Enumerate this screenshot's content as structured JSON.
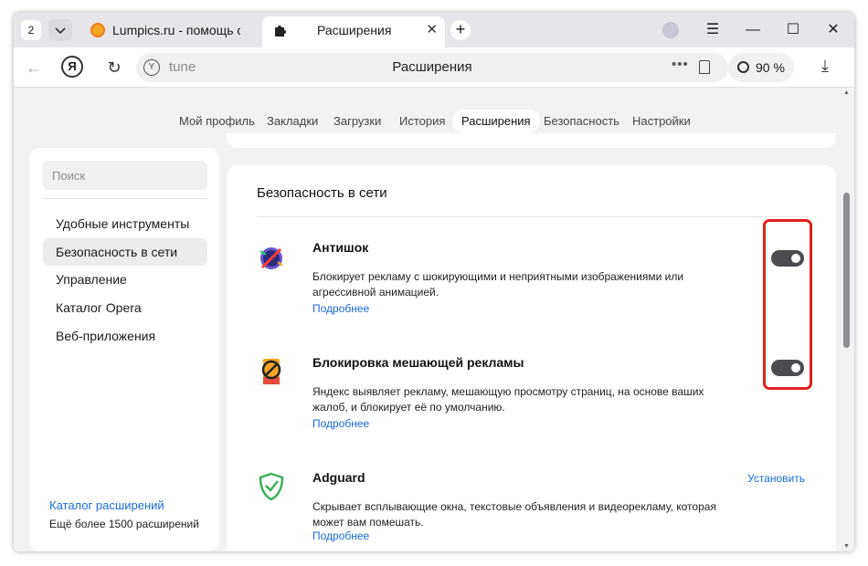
{
  "tabstrip": {
    "tab_count": "2",
    "tabs": [
      {
        "title": "Lumpics.ru - помощь с компьютером",
        "icon": "orange-favicon"
      },
      {
        "title": "Расширения",
        "icon": "puzzle-icon"
      }
    ],
    "new_tab": "+"
  },
  "toolbar": {
    "ya_label": "Я",
    "omnibox_text": "tune",
    "page_title": "Расширения",
    "zoom": "90 %"
  },
  "settings_nav": {
    "items": [
      "Мой профиль",
      "Закладки",
      "Загрузки",
      "История",
      "Расширения",
      "Безопасность",
      "Настройки"
    ],
    "active": "Расширения"
  },
  "sidebar": {
    "search_placeholder": "Поиск",
    "items": [
      "Удобные инструменты",
      "Безопасность в сети",
      "Управление",
      "Каталог Opera",
      "Веб-приложения"
    ],
    "active": "Безопасность в сети",
    "catalog_link": "Каталог расширений",
    "catalog_sub": "Ещё более 1500 расширений"
  },
  "main": {
    "section_title": "Безопасность в сети",
    "extensions": [
      {
        "name": "Антишок",
        "description": "Блокирует рекламу с шокирующими и неприятными изображениями или агрессивной анимацией.",
        "more": "Подробнее",
        "enabled": true
      },
      {
        "name": "Блокировка мешающей рекламы",
        "description": "Яндекс выявляет рекламу, мешающую просмотру страниц, на основе ваших жалоб, и блокирует её по умолчанию.",
        "more": "Подробнее",
        "enabled": true
      },
      {
        "name": "Adguard",
        "description": "Скрывает всплывающие окна, текстовые объявления и видеорекламу, которая может вам помешать.",
        "more": "Подробнее",
        "install": "Установить"
      }
    ]
  },
  "colors": {
    "link": "#1a6ad9",
    "toggle_on": "#4b4b50",
    "highlight": "#e02020"
  }
}
